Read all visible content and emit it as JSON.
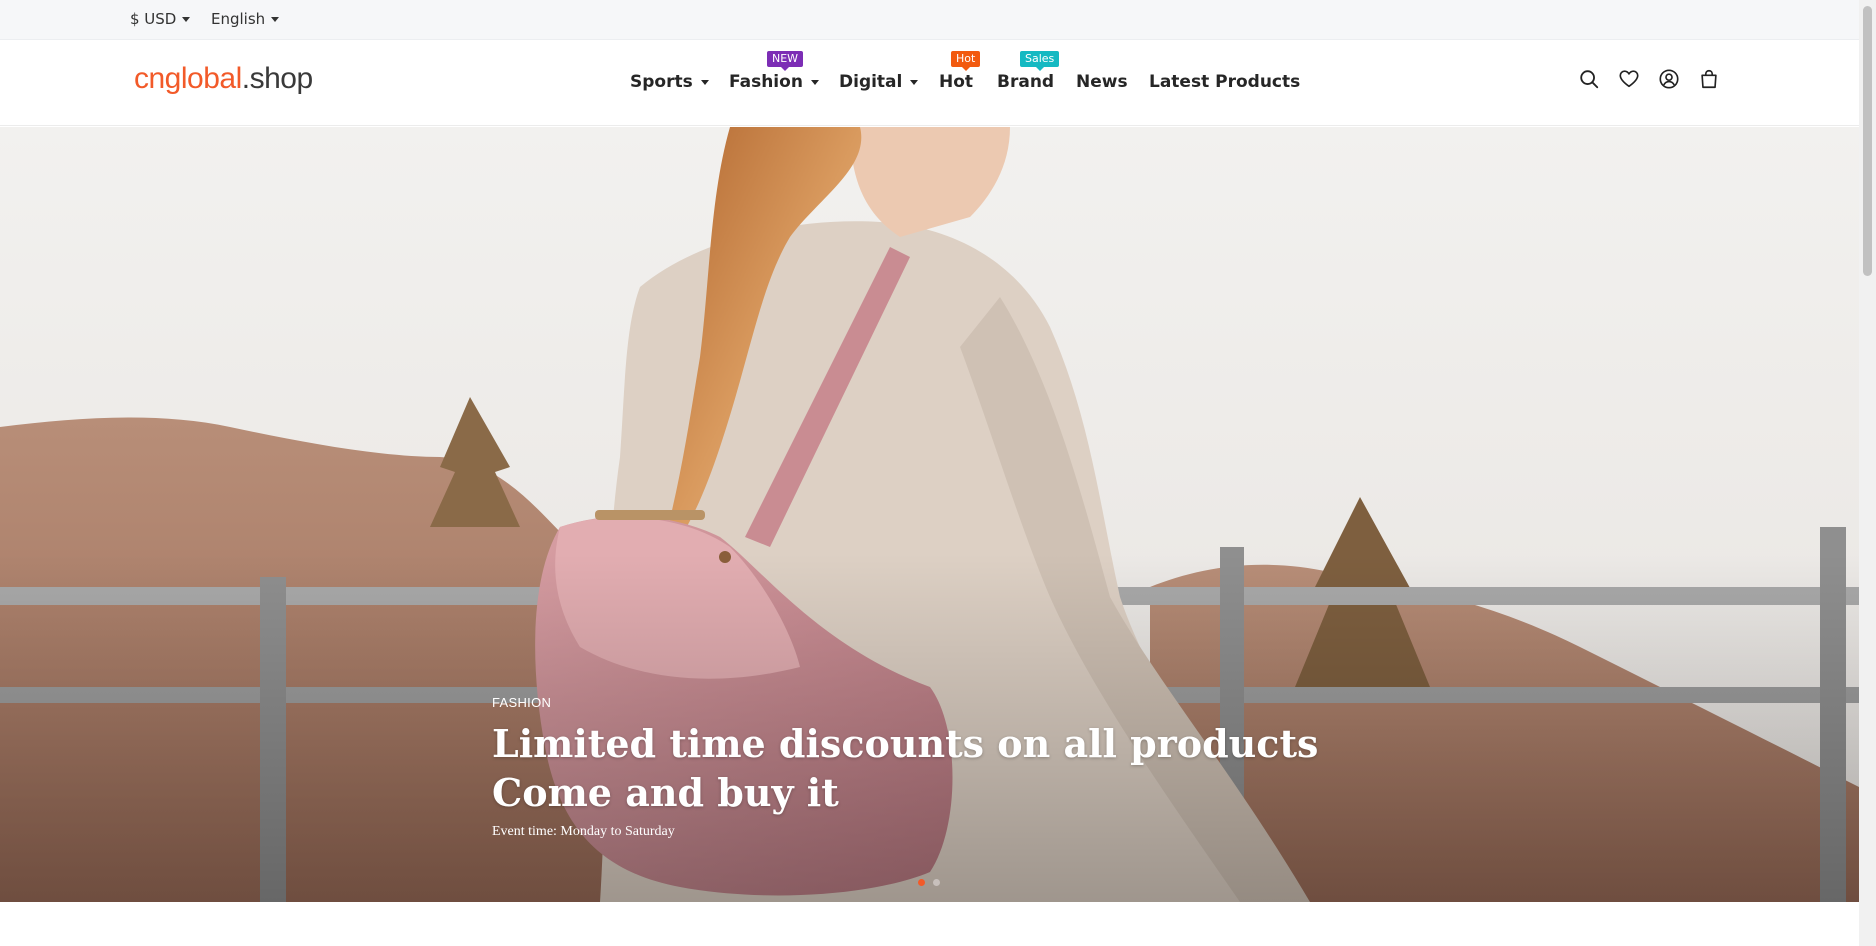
{
  "topbar": {
    "currency": "$ USD",
    "language": "English"
  },
  "header": {
    "logo_part1": "cnglobal",
    "logo_part2": ".shop",
    "nav": [
      {
        "label": "Sports",
        "dropdown": true
      },
      {
        "label": "Fashion",
        "dropdown": true,
        "tag": "NEW"
      },
      {
        "label": "Digital",
        "dropdown": true
      },
      {
        "label": "Hot",
        "tag": "Hot"
      },
      {
        "label": "Brand",
        "tag": "Sales"
      },
      {
        "label": "News"
      },
      {
        "label": "Latest Products"
      }
    ],
    "icons": [
      "search-icon",
      "heart-icon",
      "user-icon",
      "bag-icon"
    ]
  },
  "hero": {
    "category": "FASHION",
    "title_line1": "Limited time discounts on all products",
    "title_line2": "Come and buy it",
    "event": "Event time: Monday to Saturday",
    "slides": 2,
    "active_slide": 1
  },
  "colors": {
    "brand": "#f25a29",
    "tag_new": "#7c2db5",
    "tag_hot": "#f25a0f",
    "tag_sales": "#14b9c2"
  }
}
